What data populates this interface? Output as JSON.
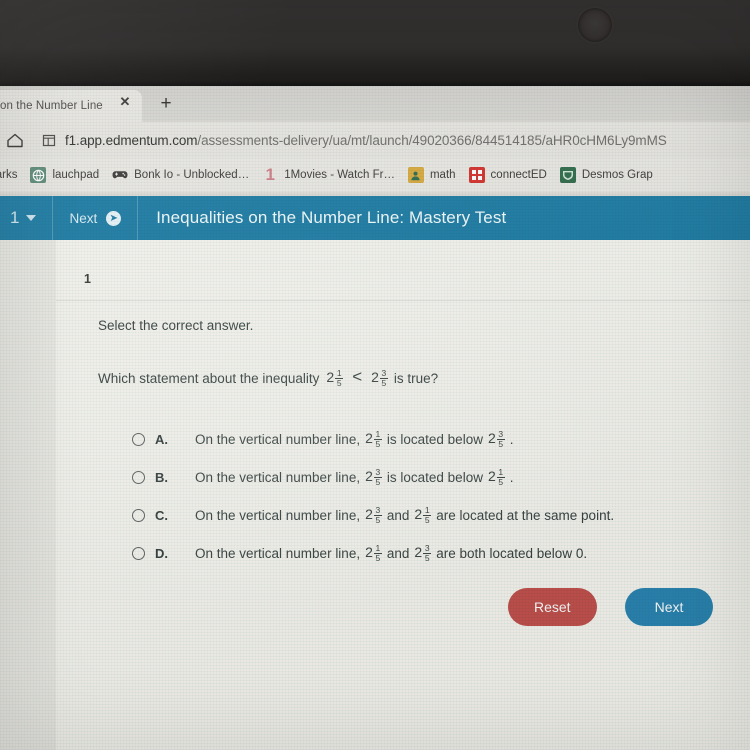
{
  "browser": {
    "tab": {
      "title": "on the Number Line",
      "close_label": "✕",
      "newtab_label": "+"
    },
    "omnibox": {
      "home_icon": "home-icon",
      "site_icon": "page-info-icon",
      "url_host": "f1.app.edmentum.com",
      "url_path": "/assessments-delivery/ua/mt/launch/49020366/844514185/aHR0cHM6Ly9mMS"
    },
    "bookmarks_label": "okmarks",
    "bookmarks": [
      {
        "label": "lauchpad",
        "icon": "globe-icon",
        "icon_color": "#4d7d6b",
        "glyph": "◍"
      },
      {
        "label": "Bonk Io - Unblocked…",
        "icon": "gamepad-icon",
        "icon_color": "#3b3a38",
        "glyph": "ἺE"
      },
      {
        "label": "1Movies - Watch Fr…",
        "icon": "one-icon",
        "icon_color": "#d47f86",
        "glyph": "1"
      },
      {
        "label": "math",
        "icon": "person-icon",
        "icon_color": "#d7a93c",
        "glyph": "■"
      },
      {
        "label": "connectED",
        "icon": "connected-icon",
        "icon_color": "#d4302c",
        "glyph": "▤"
      },
      {
        "label": "Desmos Grap",
        "icon": "desmos-icon",
        "icon_color": "#2f6b4a",
        "glyph": "▼"
      }
    ]
  },
  "app_header": {
    "question_number": "1",
    "question_dropdown_icon": "chevron-down-icon",
    "next_label": "Next",
    "next_arrow_icon": "arrow-right-circle-icon",
    "title": "Inequalities on the Number Line: Mastery Test",
    "background_color": "#1c7ba3"
  },
  "question": {
    "index": "1",
    "instruction": "Select the correct answer.",
    "stem_before": "Which statement about the inequality",
    "stem_after": "is true?",
    "relation": "<",
    "left_value": {
      "whole": "2",
      "num": "1",
      "den": "5"
    },
    "right_value": {
      "whole": "2",
      "num": "3",
      "den": "5"
    },
    "options": [
      {
        "letter": "A.",
        "selected": false,
        "segments": [
          {
            "type": "text",
            "value": "On the vertical number line,"
          },
          {
            "type": "frac",
            "whole": "2",
            "num": "1",
            "den": "5"
          },
          {
            "type": "text",
            "value": "is located below"
          },
          {
            "type": "frac",
            "whole": "2",
            "num": "3",
            "den": "5"
          },
          {
            "type": "text",
            "value": "."
          }
        ]
      },
      {
        "letter": "B.",
        "selected": false,
        "segments": [
          {
            "type": "text",
            "value": "On the vertical number line,"
          },
          {
            "type": "frac",
            "whole": "2",
            "num": "3",
            "den": "5"
          },
          {
            "type": "text",
            "value": "is located below"
          },
          {
            "type": "frac",
            "whole": "2",
            "num": "1",
            "den": "5"
          },
          {
            "type": "text",
            "value": "."
          }
        ]
      },
      {
        "letter": "C.",
        "selected": false,
        "segments": [
          {
            "type": "text",
            "value": "On the vertical number line,"
          },
          {
            "type": "frac",
            "whole": "2",
            "num": "3",
            "den": "5"
          },
          {
            "type": "text",
            "value": "and"
          },
          {
            "type": "frac",
            "whole": "2",
            "num": "1",
            "den": "5"
          },
          {
            "type": "text",
            "value": "are located at the same point."
          }
        ]
      },
      {
        "letter": "D.",
        "selected": false,
        "segments": [
          {
            "type": "text",
            "value": "On the vertical number line,"
          },
          {
            "type": "frac",
            "whole": "2",
            "num": "1",
            "den": "5"
          },
          {
            "type": "text",
            "value": "and"
          },
          {
            "type": "frac",
            "whole": "2",
            "num": "3",
            "den": "5"
          },
          {
            "type": "text",
            "value": "are both located below 0."
          }
        ]
      }
    ]
  },
  "actions": {
    "reset_label": "Reset",
    "reset_color": "#c0504c",
    "next_label": "Next",
    "next_color": "#2a84b0"
  }
}
